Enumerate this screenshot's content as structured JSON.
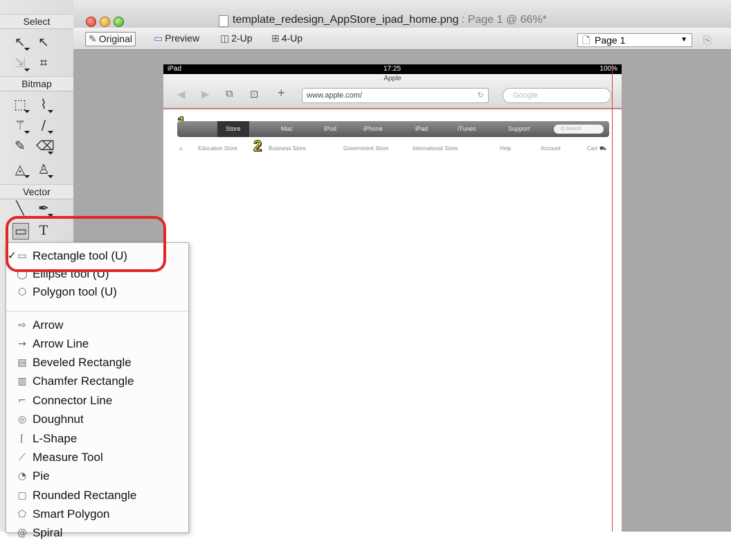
{
  "tool_panel": {
    "select_label": "Select",
    "bitmap_label": "Bitmap",
    "vector_label": "Vector",
    "select_tools": [
      {
        "icon": "pointer-icon",
        "glyph": "↖"
      },
      {
        "icon": "subselect-icon",
        "glyph": "↖"
      },
      {
        "icon": "scale-icon",
        "glyph": "⇲"
      },
      {
        "icon": "crop-icon",
        "glyph": "⌗"
      }
    ],
    "bitmap_tools": [
      {
        "icon": "marquee-icon",
        "glyph": "⬚"
      },
      {
        "icon": "lasso-icon",
        "glyph": "⌇"
      },
      {
        "icon": "magic-wand-icon",
        "glyph": "⚚"
      },
      {
        "icon": "brush-icon",
        "glyph": "∕"
      },
      {
        "icon": "pencil-icon",
        "glyph": "✎"
      },
      {
        "icon": "eraser-icon",
        "glyph": "⌫"
      },
      {
        "icon": "blur-icon",
        "glyph": "◬"
      },
      {
        "icon": "rubber-stamp-icon",
        "glyph": "♙"
      }
    ],
    "vector_tools": [
      {
        "icon": "line-icon",
        "glyph": "╲"
      },
      {
        "icon": "pen-icon",
        "glyph": "✒"
      },
      {
        "icon": "rectangle-tool-icon",
        "glyph": "▭"
      },
      {
        "icon": "text-tool-icon",
        "glyph": "T"
      }
    ]
  },
  "window": {
    "doc_name": "template_redesign_AppStore_ipad_home.png",
    "doc_meta": " : Page 1 @ 66%*"
  },
  "view_bar": {
    "original": "Original",
    "preview": "Preview",
    "two_up": "2-Up",
    "four_up": "4-Up",
    "page_value": "Page 1"
  },
  "ipad": {
    "device": "iPad",
    "time": "17:25",
    "battery": "100%",
    "page_title": "Apple",
    "url": "www.apple.com/",
    "search_placeholder": "Google",
    "nav": [
      "Store",
      "Mac",
      "iPod",
      "iPhone",
      "iPad",
      "iTunes",
      "Support"
    ],
    "nav_search": "Q Search",
    "subnav": [
      "Education Store",
      "Business Store",
      "Government Store",
      "International Store",
      "Help",
      "Account",
      "Cart"
    ],
    "callout_1": "1",
    "callout_2": "2"
  },
  "flyout": {
    "items": [
      {
        "label": "Rectangle tool (U)",
        "icon": "rectangle-icon",
        "glyph": "▭",
        "checked": true
      },
      {
        "label": "Ellipse tool (U)",
        "icon": "ellipse-icon",
        "glyph": "◯"
      },
      {
        "label": "Polygon tool (U)",
        "icon": "polygon-icon",
        "glyph": "⬡"
      },
      {
        "label": "Arrow",
        "icon": "arrow-icon",
        "glyph": "⇨"
      },
      {
        "label": "Arrow Line",
        "icon": "arrow-line-icon",
        "glyph": "→"
      },
      {
        "label": "Beveled Rectangle",
        "icon": "beveled-rectangle-icon",
        "glyph": "▤"
      },
      {
        "label": "Chamfer Rectangle",
        "icon": "chamfer-rectangle-icon",
        "glyph": "▥"
      },
      {
        "label": "Connector Line",
        "icon": "connector-line-icon",
        "glyph": "⌐"
      },
      {
        "label": "Doughnut",
        "icon": "doughnut-icon",
        "glyph": "◎"
      },
      {
        "label": "L-Shape",
        "icon": "l-shape-icon",
        "glyph": "⌈"
      },
      {
        "label": "Measure Tool",
        "icon": "measure-tool-icon",
        "glyph": "⟋"
      },
      {
        "label": "Pie",
        "icon": "pie-icon",
        "glyph": "◔"
      },
      {
        "label": "Rounded Rectangle",
        "icon": "rounded-rectangle-icon",
        "glyph": "▢"
      },
      {
        "label": "Smart Polygon",
        "icon": "smart-polygon-icon",
        "glyph": "⬠"
      },
      {
        "label": "Spiral",
        "icon": "spiral-icon",
        "glyph": "@"
      }
    ]
  },
  "colors": {
    "highlight_ring": "#e22727",
    "guide_line": "#d43c3c",
    "callout": "#f6e21a"
  }
}
